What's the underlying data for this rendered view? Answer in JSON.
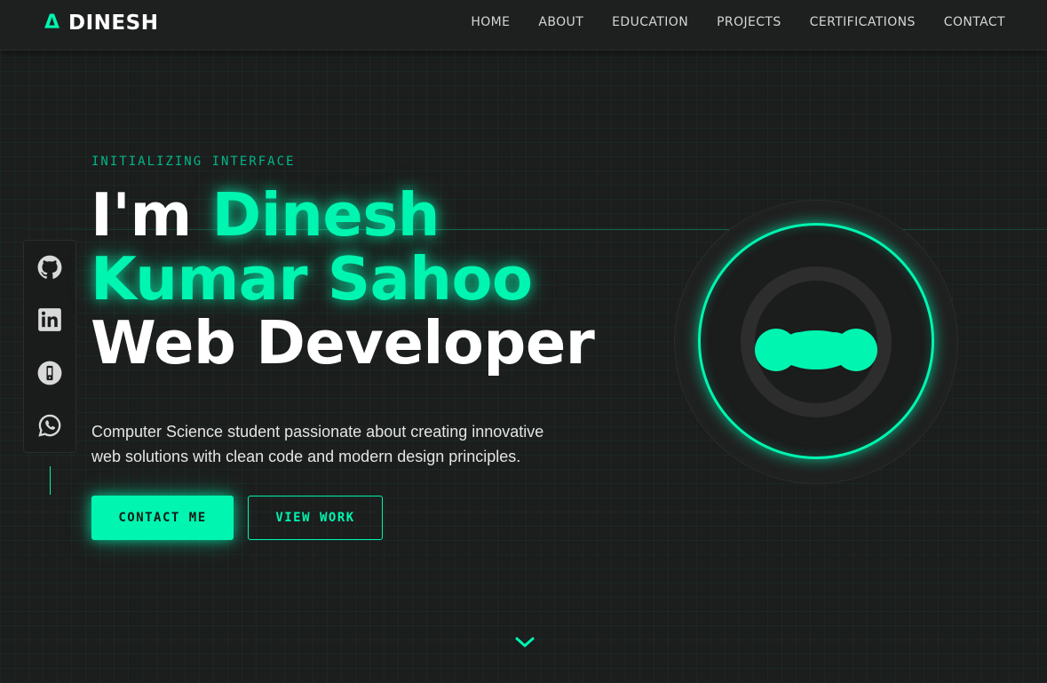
{
  "brand": {
    "icon": "Δ",
    "name": "DINESH"
  },
  "nav": {
    "items": [
      {
        "label": "HOME"
      },
      {
        "label": "ABOUT"
      },
      {
        "label": "EDUCATION"
      },
      {
        "label": "PROJECTS"
      },
      {
        "label": "CERTIFICATIONS"
      },
      {
        "label": "CONTACT"
      }
    ]
  },
  "social": {
    "items": [
      {
        "icon": "github-icon"
      },
      {
        "icon": "linkedin-icon"
      },
      {
        "icon": "phone-icon"
      },
      {
        "icon": "whatsapp-icon"
      }
    ]
  },
  "hero": {
    "eyebrow": "INITIALIZING INTERFACE",
    "greeting": "I'm ",
    "name_line1": "Dinesh",
    "name_line2": "Kumar Sahoo",
    "role": "Web Developer",
    "description": "Computer Science student passionate about creating innovative web solutions with clean code and modern design principles.",
    "primary_button": "CONTACT ME",
    "secondary_button": "VIEW WORK"
  },
  "colors": {
    "accent": "#00f5b0",
    "background": "#1c1d1d",
    "text": "#ffffff"
  }
}
